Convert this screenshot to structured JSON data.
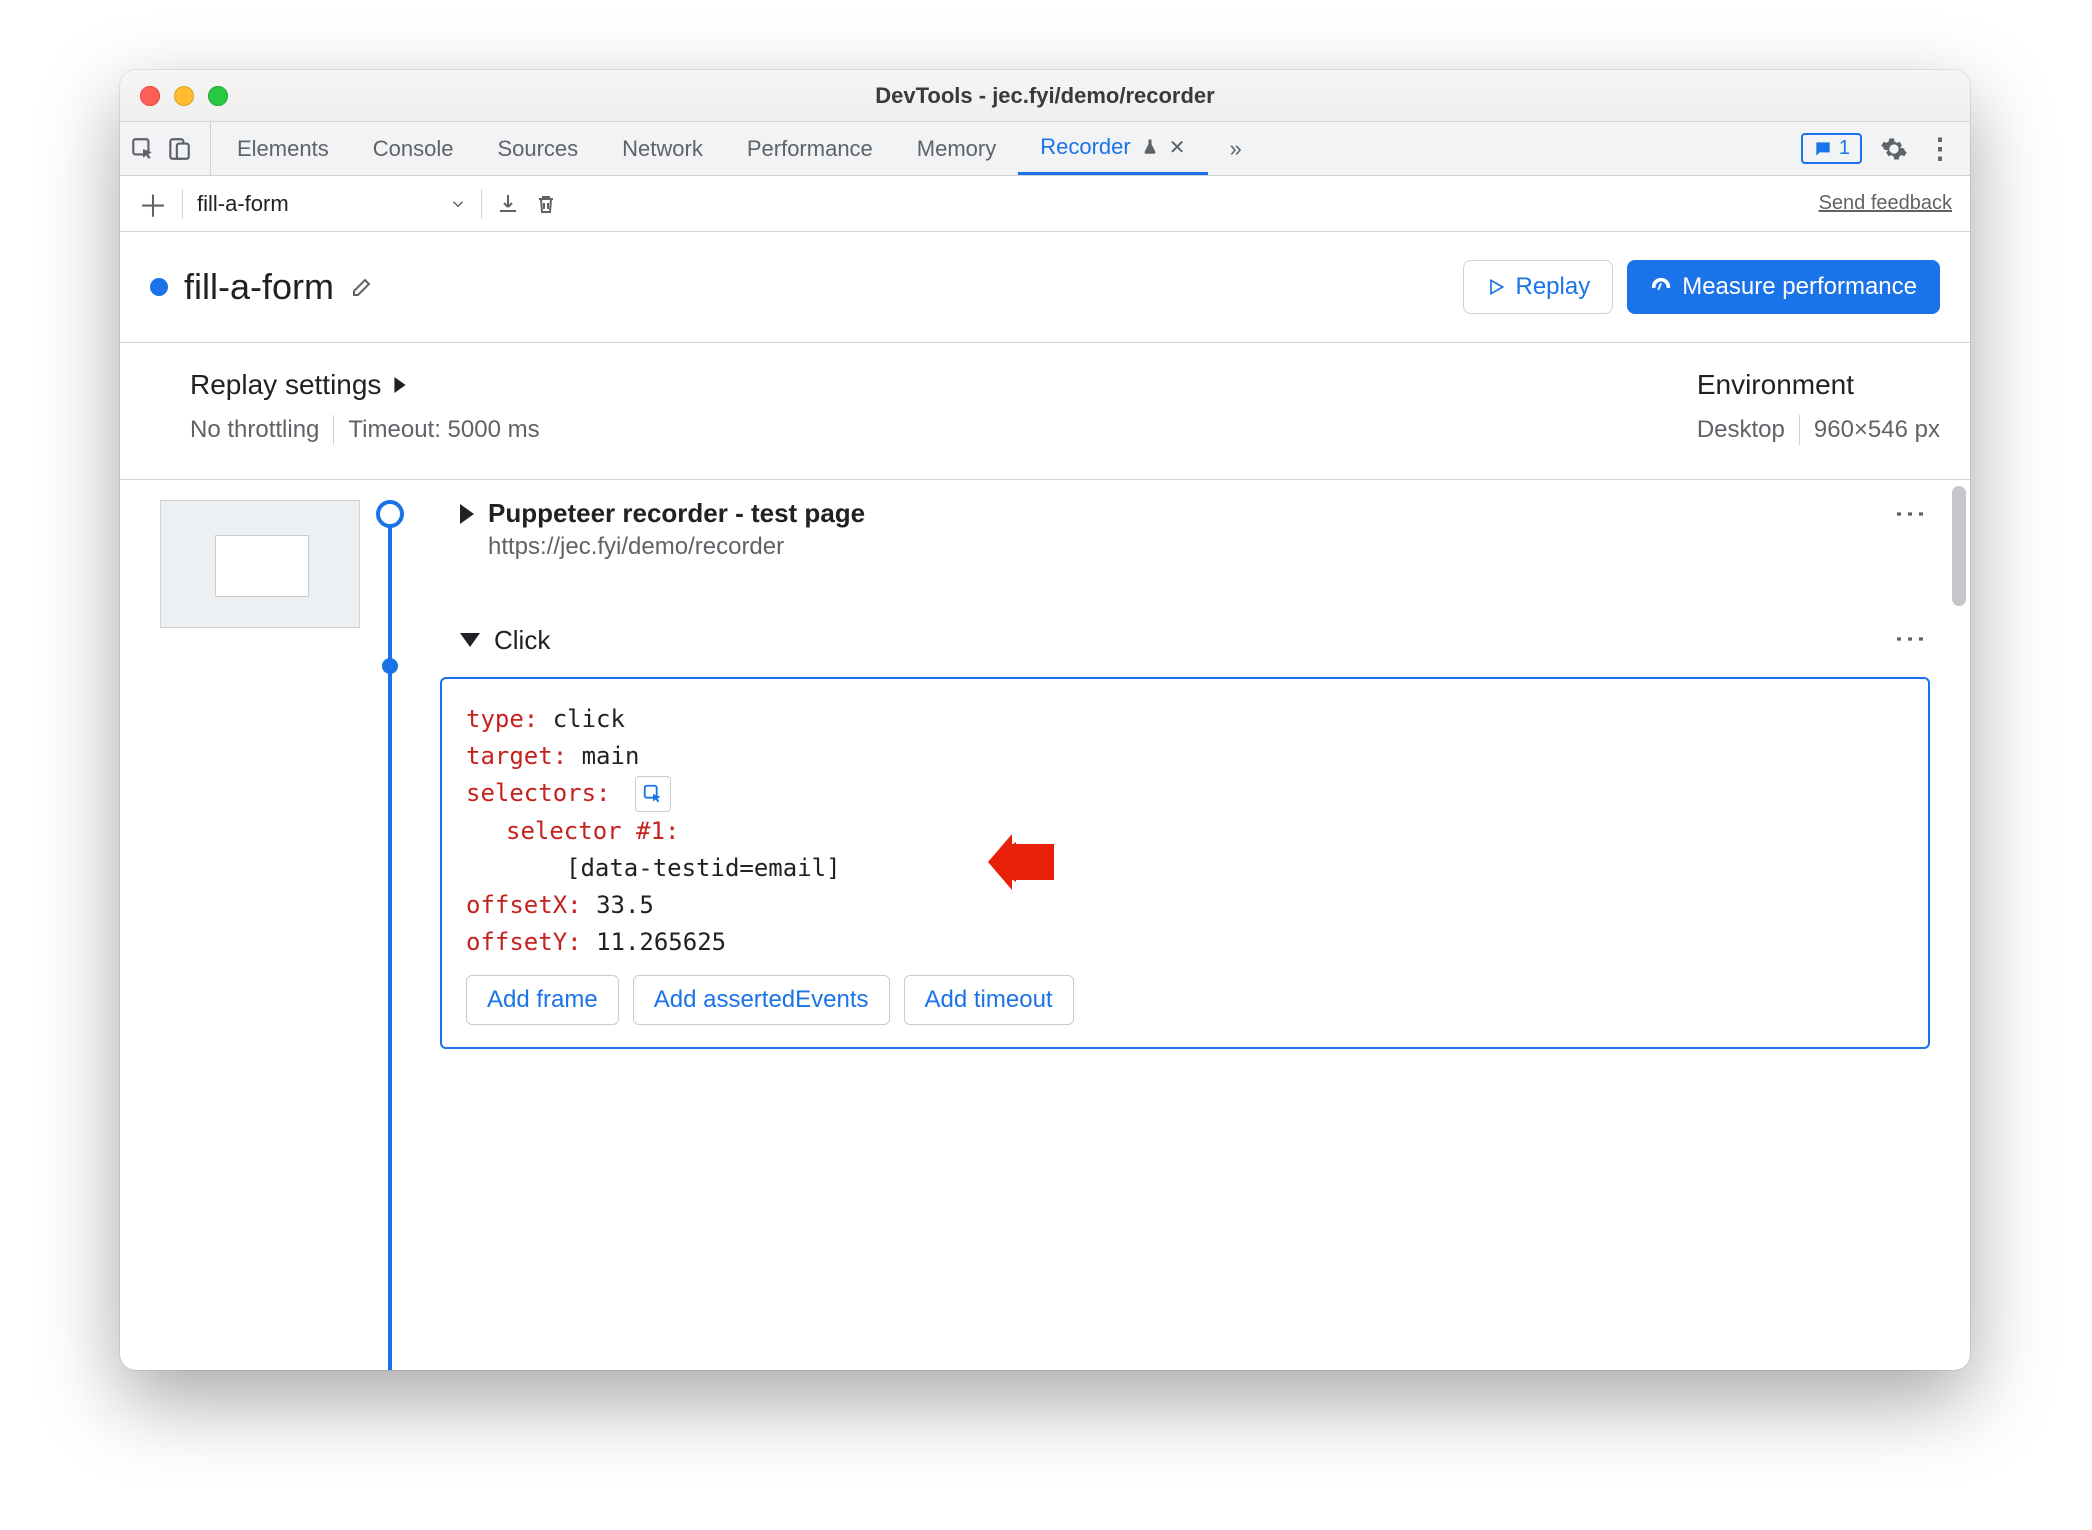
{
  "window": {
    "title": "DevTools - jec.fyi/demo/recorder"
  },
  "tabs": {
    "items": [
      "Elements",
      "Console",
      "Sources",
      "Network",
      "Performance",
      "Memory"
    ],
    "active": "Recorder",
    "overflow": "»"
  },
  "issues": {
    "count": "1"
  },
  "toolbar": {
    "new_label": "+",
    "recording_name": "fill-a-form",
    "send_feedback": "Send feedback"
  },
  "header": {
    "title": "fill-a-form",
    "replay": "Replay",
    "measure": "Measure performance"
  },
  "settings": {
    "replay_heading": "Replay settings",
    "throttling": "No throttling",
    "timeout": "Timeout: 5000 ms",
    "env_heading": "Environment",
    "env_kind": "Desktop",
    "env_size": "960×546 px"
  },
  "steps": {
    "initial": {
      "title": "Puppeteer recorder - test page",
      "url": "https://jec.fyi/demo/recorder"
    },
    "click": {
      "label": "Click",
      "type_key": "type",
      "type_val": "click",
      "target_key": "target",
      "target_val": "main",
      "selectors_key": "selectors",
      "selector1_key": "selector #1",
      "selector1_val": "[data-testid=email]",
      "offsetX_key": "offsetX",
      "offsetX_val": "33.5",
      "offsetY_key": "offsetY",
      "offsetY_val": "11.265625"
    },
    "add_frame": "Add frame",
    "add_asserted": "Add assertedEvents",
    "add_timeout": "Add timeout"
  }
}
